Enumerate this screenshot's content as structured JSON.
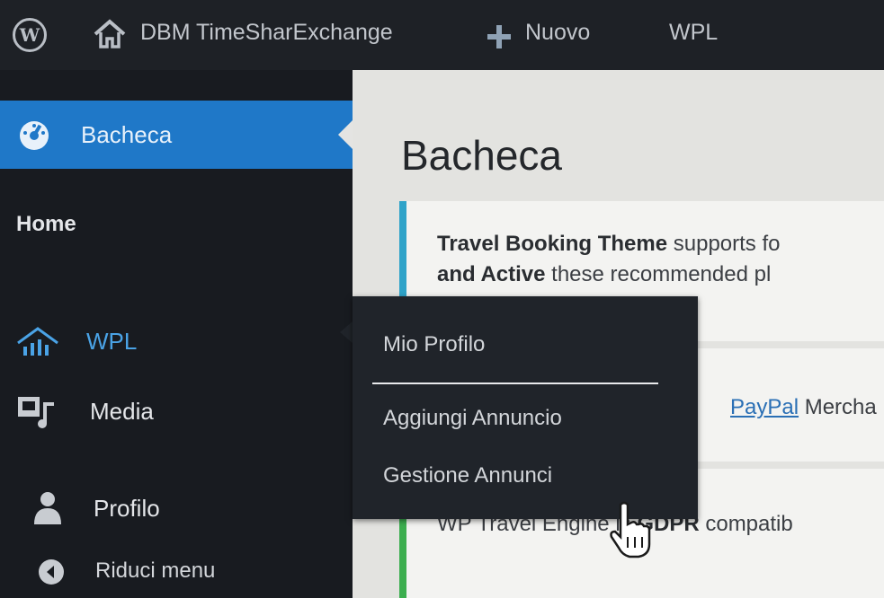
{
  "adminbar": {
    "site_name": "DBM TimeSharExchange",
    "new_label": "Nuovo",
    "plugin_label": "WPL"
  },
  "sidebar": {
    "items": [
      {
        "label": "Bacheca",
        "icon": "dashboard-icon",
        "active": true
      },
      {
        "label": "Home",
        "submenu": true
      },
      {
        "label": "WPL",
        "icon": "wpl-house-icon",
        "highlighted": true
      },
      {
        "label": "Media",
        "icon": "media-icon"
      },
      {
        "label": "Profilo",
        "icon": "user-icon"
      },
      {
        "label": "Riduci menu",
        "icon": "collapse-icon"
      }
    ]
  },
  "flyout": {
    "items": [
      {
        "label": "Mio Profilo"
      },
      {
        "label": "Aggiungi Annuncio"
      },
      {
        "label": "Gestione Annunci"
      }
    ]
  },
  "main": {
    "title": "Bacheca",
    "notices": [
      {
        "bold": "Travel Booking Theme",
        "text": " supports fo",
        "line2_bold": "and Active",
        "line2_text": " these recommended pl"
      },
      {
        "link": "PayPal",
        "text": " Mercha"
      },
      {
        "text_prefix": "WP Travel Engine is ",
        "bold": "GDPR",
        "text": " compatib"
      }
    ]
  },
  "colors": {
    "adminbar_bg": "#1e2126",
    "sidebar_bg": "#181b20",
    "active_bg": "#1f78c8",
    "wpl_text": "#4aa3e6",
    "content_bg": "#e3e3e0",
    "notice_info_border": "#2fa3c9",
    "notice_success_border": "#3cae4f"
  }
}
